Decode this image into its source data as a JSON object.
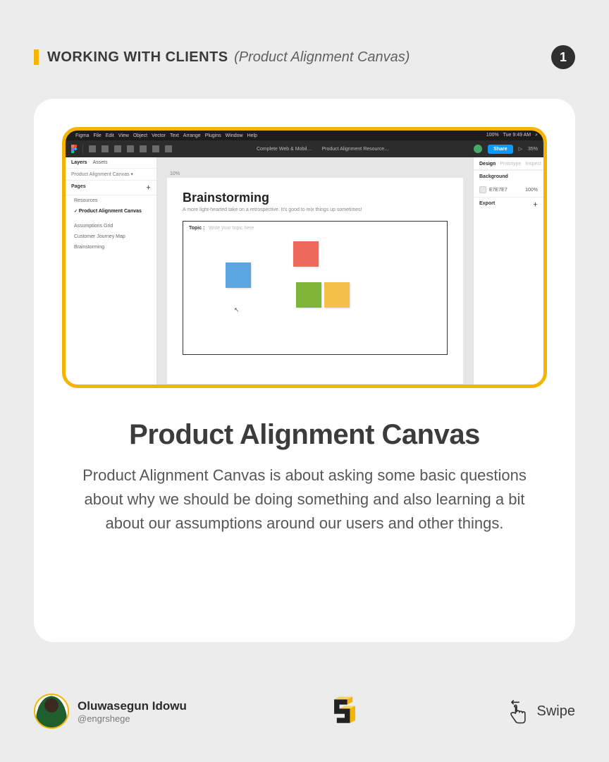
{
  "header": {
    "title": "WORKING WITH CLIENTS",
    "subtitle": "(Product Alignment Canvas)",
    "page": "1"
  },
  "card": {
    "title": "Product Alignment Canvas",
    "body": "Product Alignment Canvas is about asking some basic questions about why we should be doing something and also learning a bit about our assumptions around our users and other things."
  },
  "figma": {
    "mac_menu_left": [
      "Figma",
      "File",
      "Edit",
      "View",
      "Object",
      "Vector",
      "Text",
      "Arrange",
      "Plugins",
      "Window",
      "Help"
    ],
    "mac_menu_right": [
      "100%",
      "Tue 9:49 AM"
    ],
    "doc_title_1": "Complete Web & Mobil…",
    "doc_title_2": "Product Alignment Resource…",
    "share": "Share",
    "zoom": "35%",
    "left_tabs": [
      "Layers",
      "Assets"
    ],
    "breadcrumb": "Product Alignment Canvas ▾",
    "pages_label": "Pages",
    "pages": [
      "Resources",
      "Product Alignment Canvas",
      "Assumptions Grid",
      "Customer Journey Map",
      "Brainstorming"
    ],
    "pages_selected_index": 1,
    "canvas_tab": "10%",
    "canvas_heading": "Brainstorming",
    "canvas_sub": "A more light-hearted take on a retrospective. It's good to mix things up sometimes!",
    "topic_label": "Topic :",
    "topic_hint": "Write your topic here",
    "right_tabs": [
      "Design",
      "Prototype",
      "Inspect"
    ],
    "bg_label": "Background",
    "bg_hex": "E7E7E7",
    "bg_opacity": "100%",
    "export_label": "Export"
  },
  "footer": {
    "author_name": "Oluwasegun Idowu",
    "author_handle": "@engrshege",
    "swipe": "Swipe"
  }
}
